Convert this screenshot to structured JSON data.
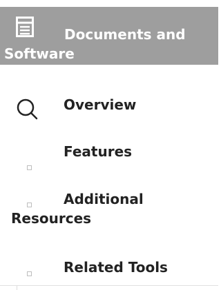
{
  "header": {
    "title": "Documents and Software",
    "icon": "document-icon",
    "background": "#9e9e9e"
  },
  "nav": {
    "items": [
      {
        "label": "Overview",
        "icon": "search-icon"
      },
      {
        "label": "Features",
        "icon": "bullet-icon"
      },
      {
        "label": "Additional Resources",
        "icon": "bullet-icon"
      },
      {
        "label": "Related Tools",
        "icon": "bullet-icon"
      }
    ]
  }
}
